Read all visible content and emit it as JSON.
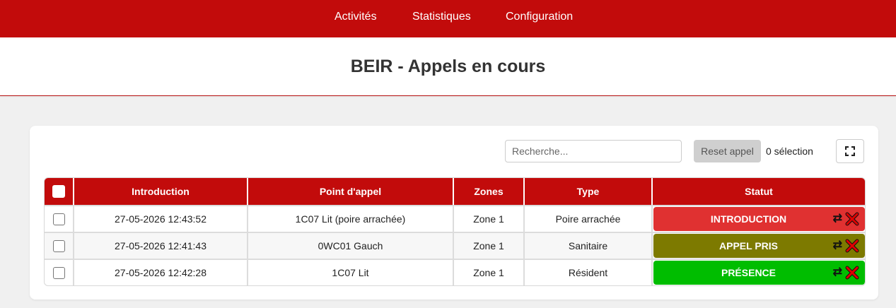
{
  "nav": {
    "items": [
      {
        "label": "Activités"
      },
      {
        "label": "Statistiques"
      },
      {
        "label": "Configuration"
      }
    ]
  },
  "page": {
    "title": "BEIR - Appels en cours"
  },
  "toolbar": {
    "search_placeholder": "Recherche...",
    "search_value": "",
    "reset_label": "Reset appel",
    "selection_text": "0 sélection",
    "fullscreen_icon": "fullscreen-icon"
  },
  "table": {
    "headers": {
      "introduction": "Introduction",
      "point": "Point d'appel",
      "zones": "Zones",
      "type": "Type",
      "statut": "Statut"
    },
    "rows": [
      {
        "introduction": "27-05-2026 12:43:52",
        "point": "1C07 Lit (poire arrachée)",
        "zone": "Zone 1",
        "type": "Poire arrachée",
        "status": "INTRODUCTION",
        "status_color": "#e03131"
      },
      {
        "introduction": "27-05-2026 12:41:43",
        "point": "0WC01 Gauch",
        "zone": "Zone 1",
        "type": "Sanitaire",
        "status": "APPEL PRIS",
        "status_color": "#7d7a00"
      },
      {
        "introduction": "27-05-2026 12:42:28",
        "point": "1C07 Lit",
        "zone": "Zone 1",
        "type": "Résident",
        "status": "PRÉSENCE",
        "status_color": "#00bd00"
      }
    ]
  },
  "colors": {
    "brand": "#c20b0b",
    "cancel_icon": "#e00000"
  }
}
